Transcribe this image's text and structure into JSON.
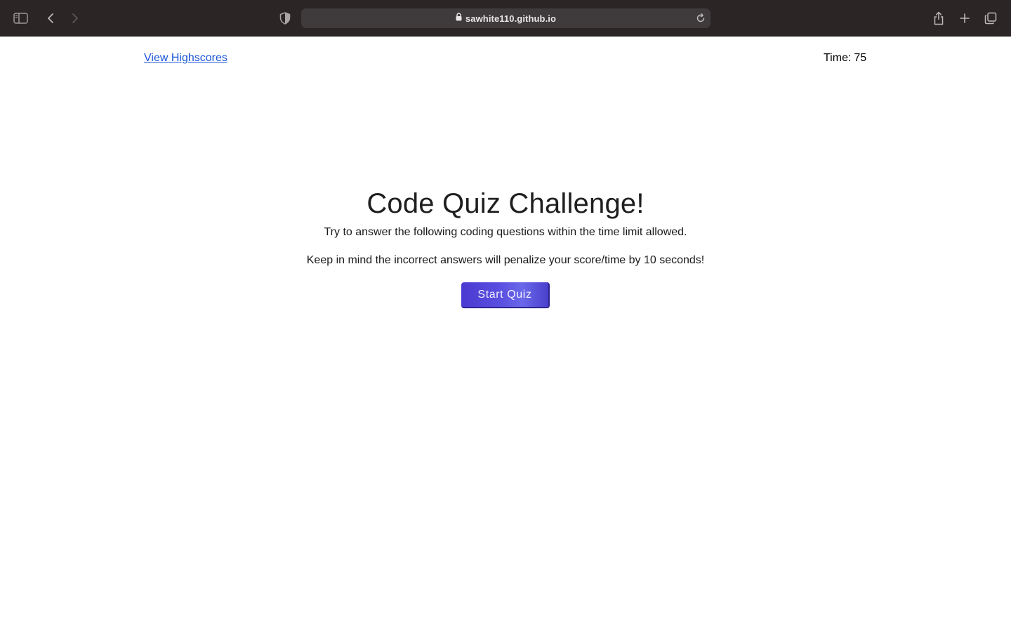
{
  "browser": {
    "url": "sawhite110.github.io",
    "icons": [
      "sidebar-icon",
      "back-icon",
      "forward-icon",
      "shield-icon",
      "lock-icon",
      "reload-icon",
      "share-icon",
      "new-tab-icon",
      "tabs-overview-icon"
    ]
  },
  "header": {
    "highscores_link": "View Highscores",
    "timer_label": "Time:",
    "timer_value": "75"
  },
  "quiz": {
    "title": "Code Quiz Challenge!",
    "intro": "Try to answer the following coding questions within the time limit allowed.",
    "warning": "Keep in mind the incorrect answers will penalize your score/time by 10 seconds!",
    "start_button": "Start Quiz"
  },
  "colors": {
    "toolbar": "#2b2526",
    "link": "#1a55d6",
    "button": "#5a4fe0"
  }
}
